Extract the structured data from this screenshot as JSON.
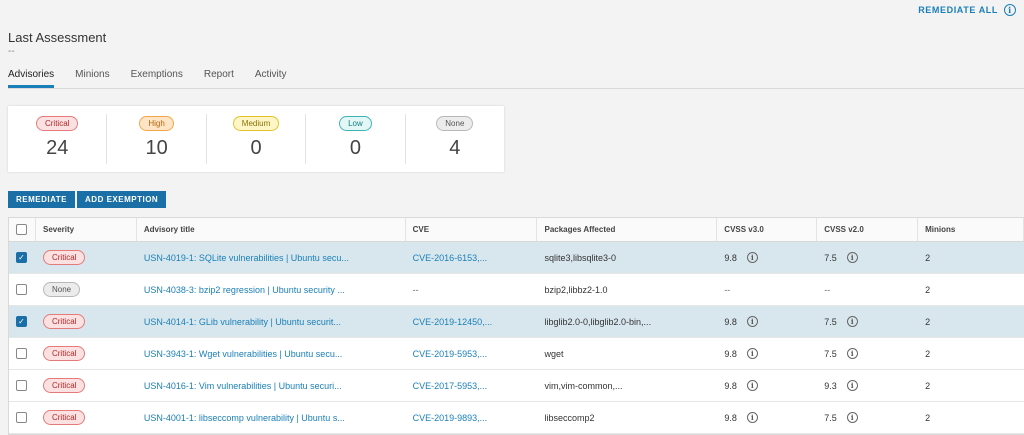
{
  "header": {
    "remediate_all": "REMEDIATE ALL",
    "title": "Last Assessment",
    "subtitle": "--"
  },
  "tabs": [
    {
      "label": "Advisories",
      "active": true
    },
    {
      "label": "Minions"
    },
    {
      "label": "Exemptions"
    },
    {
      "label": "Report"
    },
    {
      "label": "Activity"
    }
  ],
  "summary": [
    {
      "label": "Critical",
      "count": "24"
    },
    {
      "label": "High",
      "count": "10"
    },
    {
      "label": "Medium",
      "count": "0"
    },
    {
      "label": "Low",
      "count": "0"
    },
    {
      "label": "None",
      "count": "4"
    }
  ],
  "actions": {
    "remediate": "REMEDIATE",
    "add_exemption": "ADD EXEMPTION"
  },
  "table": {
    "columns": [
      "Severity",
      "Advisory title",
      "CVE",
      "Packages Affected",
      "CVSS v3.0",
      "CVSS v2.0",
      "Minions"
    ],
    "rows": [
      {
        "checked": true,
        "severity": "Critical",
        "title": "USN-4019-1: SQLite vulnerabilities | Ubuntu secu...",
        "cve": "CVE-2016-6153,...",
        "packages": "sqlite3,libsqlite3-0",
        "cvss3": "9.8",
        "cvss2": "7.5",
        "minions": "2"
      },
      {
        "checked": false,
        "severity": "None",
        "title": "USN-4038-3: bzip2 regression | Ubuntu security ...",
        "cve": "--",
        "packages": "bzip2,libbz2-1.0",
        "cvss3": "--",
        "cvss2": "--",
        "minions": "2"
      },
      {
        "checked": true,
        "severity": "Critical",
        "title": "USN-4014-1: GLib vulnerability | Ubuntu securit...",
        "cve": "CVE-2019-12450,...",
        "packages": "libglib2.0-0,libglib2.0-bin,...",
        "cvss3": "9.8",
        "cvss2": "7.5",
        "minions": "2"
      },
      {
        "checked": false,
        "severity": "Critical",
        "title": "USN-3943-1: Wget vulnerabilities | Ubuntu secu...",
        "cve": "CVE-2019-5953,...",
        "packages": "wget",
        "cvss3": "9.8",
        "cvss2": "7.5",
        "minions": "2"
      },
      {
        "checked": false,
        "severity": "Critical",
        "title": "USN-4016-1: Vim vulnerabilities | Ubuntu securi...",
        "cve": "CVE-2017-5953,...",
        "packages": "vim,vim-common,...",
        "cvss3": "9.8",
        "cvss2": "9.3",
        "minions": "2"
      },
      {
        "checked": false,
        "severity": "Critical",
        "title": "USN-4001-1: libseccomp vulnerability | Ubuntu s...",
        "cve": "CVE-2019-9893,...",
        "packages": "libseccomp2",
        "cvss3": "9.8",
        "cvss2": "7.5",
        "minions": "2"
      }
    ]
  },
  "colors": {
    "accent": "#1a7fb8",
    "button": "#1a6fa6",
    "selected_row": "#d8e7ee"
  },
  "icons": [
    "info-icon",
    "checkbox-icon"
  ]
}
